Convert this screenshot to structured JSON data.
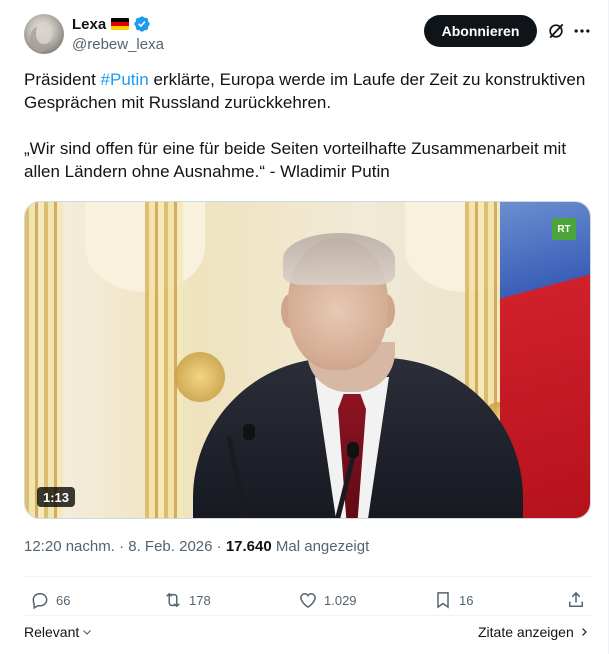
{
  "author": {
    "display_name": "Lexa",
    "handle": "@rebew_lexa"
  },
  "header": {
    "follow_label": "Abonnieren"
  },
  "tweet": {
    "line1_prefix": "Präsident ",
    "hashtag": "#Putin",
    "line1_suffix": " erklärte, Europa werde im Laufe der Zeit zu konstruktiven Gesprächen mit Russland zurückkehren.",
    "quote": "„Wir sind offen für eine für beide Seiten vorteilhafte Zusammenarbeit mit allen Ländern ohne Ausnahme.“ - Wladimir Putin"
  },
  "media": {
    "duration": "1:13",
    "channel_logo": "RT"
  },
  "meta": {
    "time": "12:20 nachm.",
    "separator": " · ",
    "date": "8. Feb. 2026",
    "views": "17.640",
    "views_label": " Mal angezeigt"
  },
  "actions": {
    "replies": "66",
    "reposts": "178",
    "likes": "1.029",
    "bookmarks": "16"
  },
  "footer": {
    "sort_label": "Relevant",
    "quotes_label": "Zitate anzeigen"
  },
  "colors": {
    "accent": "#1d9bf0",
    "text": "#0f1419",
    "muted": "#536471",
    "verified": "#1d9bf0"
  },
  "icons": [
    "verified-badge-icon",
    "grok-icon",
    "more-icon",
    "reply-icon",
    "repost-icon",
    "like-icon",
    "bookmark-icon",
    "share-icon",
    "chevron-down-icon",
    "chevron-right-icon"
  ]
}
